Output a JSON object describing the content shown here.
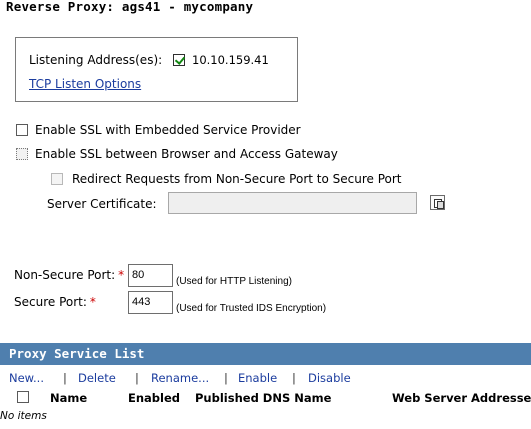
{
  "page": {
    "title": "Reverse Proxy: ags41 - mycompany"
  },
  "listening": {
    "label": "Listening Address(es):",
    "address": "10.10.159.41",
    "tcp_link": "TCP Listen Options"
  },
  "options": {
    "embedded_ssl": "Enable SSL with Embedded Service Provider",
    "browser_ssl": "Enable SSL between Browser and Access Gateway",
    "redirect": "Redirect Requests from Non-Secure Port to Secure Port"
  },
  "certificate": {
    "label": "Server Certificate:",
    "value": ""
  },
  "ports": {
    "non_secure_label": "Non-Secure Port:",
    "non_secure_value": "80",
    "non_secure_note": "(Used for HTTP Listening)",
    "secure_label": "Secure Port:",
    "secure_value": "443",
    "secure_note": "(Used for Trusted IDS Encryption)",
    "required_mark": "*"
  },
  "service_list": {
    "title": "Proxy Service List",
    "toolbar": {
      "new": "New...",
      "delete": "Delete",
      "rename": "Rename...",
      "enable": "Enable",
      "disable": "Disable",
      "separator": "|"
    },
    "columns": [
      "Name",
      "Enabled",
      "Published DNS Name",
      "Web Server Addresses"
    ],
    "empty_text": "No items"
  },
  "colors": {
    "header_bar": "#4f7fae",
    "link": "#1b3c9e",
    "required": "#cc0000"
  }
}
